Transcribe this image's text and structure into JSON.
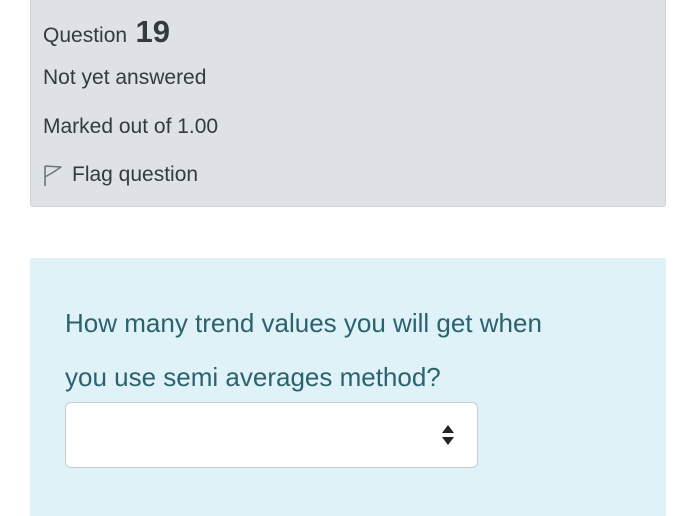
{
  "question_info": {
    "label": "Question",
    "number": "19",
    "state": "Not yet answered",
    "grade": "Marked out of 1.00",
    "flag_label": "Flag question"
  },
  "question": {
    "text_line1": "How many trend values you will get when",
    "text_line2": "you use semi averages method?",
    "answer_select": {
      "selected_value": "",
      "icon": "up-down-arrows-icon"
    }
  },
  "icons": {
    "flag": "flag-outline-icon"
  },
  "colors": {
    "info_background": "#dee2e6",
    "content_background": "#def2f8",
    "question_text": "#2c626e",
    "info_text": "#343a40"
  }
}
